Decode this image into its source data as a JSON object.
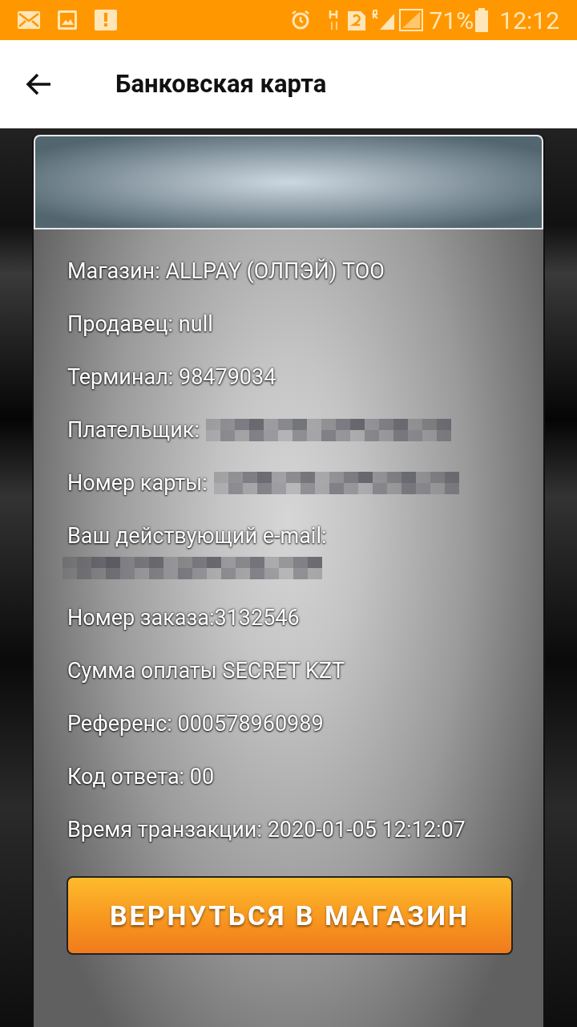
{
  "status_bar": {
    "battery": "71%",
    "time": "12:12"
  },
  "app_bar": {
    "title": "Банковская карта"
  },
  "details": [
    {
      "kind": "plain",
      "text": "Магазин: ALLPAY (ОЛПЭЙ) ТОО"
    },
    {
      "kind": "plain",
      "text": "Продавец: null"
    },
    {
      "kind": "plain",
      "text": "Терминал: 98479034"
    },
    {
      "kind": "masked",
      "text": "Плательщик:"
    },
    {
      "kind": "masked",
      "text": "Номер карты:"
    },
    {
      "kind": "masked_below",
      "text": "Ваш действующий e-mail:"
    },
    {
      "kind": "plain",
      "text": "Номер заказа:3132546"
    },
    {
      "kind": "plain",
      "text": "Сумма оплаты SECRET KZT"
    },
    {
      "kind": "plain",
      "text": "Референс: 000578960989"
    },
    {
      "kind": "plain",
      "text": "Код ответа: 00"
    },
    {
      "kind": "plain",
      "text": "Время транзакции: 2020-01-05 12:12:07"
    }
  ],
  "return_button": "ВЕРНУТЬСЯ В МАГАЗИН"
}
